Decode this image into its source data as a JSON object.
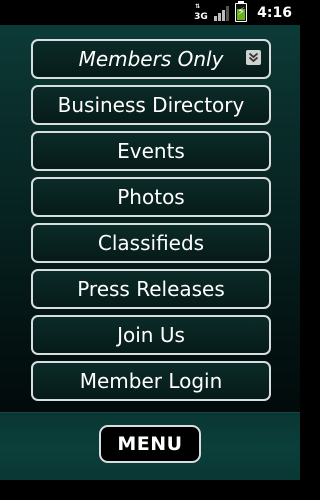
{
  "status_bar": {
    "network_label": "3G",
    "time": "4:16",
    "signal_level": 0.75,
    "battery_level": 0.7
  },
  "menu": {
    "items": [
      {
        "label": "Members Only",
        "has_dropdown": true
      },
      {
        "label": "Business Directory"
      },
      {
        "label": "Events"
      },
      {
        "label": "Photos"
      },
      {
        "label": "Classifieds"
      },
      {
        "label": "Press Releases"
      },
      {
        "label": "Join Us"
      },
      {
        "label": "Member Login"
      }
    ]
  },
  "bottom_bar": {
    "menu_button_label": "MENU"
  },
  "icons": {
    "dropdown": "chevron-down-double-icon",
    "battery": "battery-charging-icon",
    "signal": "signal-bars-icon",
    "network": "3g-data-icon"
  },
  "colors": {
    "background_top": "#0c3b37",
    "background_bottom": "#020a0a",
    "button_border": "#d8dde0",
    "battery_fill": "#67b21e"
  }
}
